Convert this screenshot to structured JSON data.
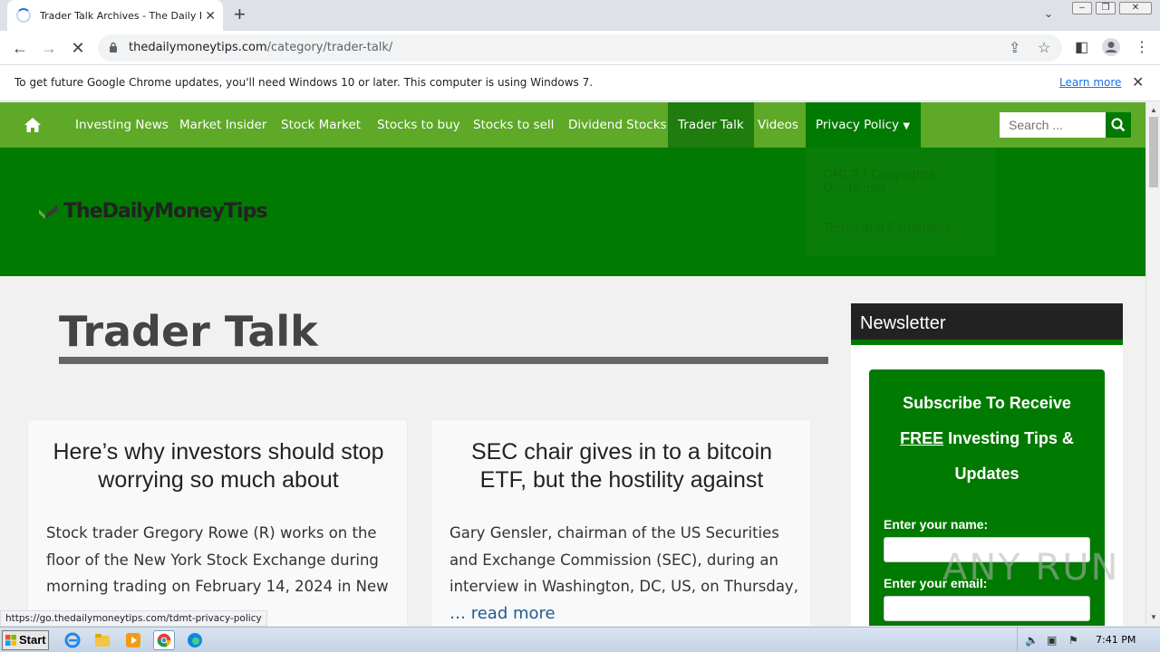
{
  "browser": {
    "tab_title": "Trader Talk Archives - The Daily Money",
    "url_host": "thedailymoneytips.com",
    "url_path": "/category/trader-talk/",
    "infobar_message": "To get future Google Chrome updates, you'll need Windows 10 or later. This computer is using Windows 7.",
    "infobar_link": "Learn more",
    "status_url": "https://go.thedailymoneytips.com/tdmt-privacy-policy"
  },
  "nav": {
    "items": [
      "Investing News",
      "Market Insider",
      "Stock Market",
      "Stocks to buy",
      "Stocks to sell",
      "Dividend Stocks",
      "Trader Talk",
      "Videos",
      "Privacy Policy"
    ],
    "search_placeholder": "Search ...",
    "dropdown": [
      "DMCA / Copyrights Disclaimer",
      "Terms and Conditions"
    ]
  },
  "logo_text": "TheDailyMoneyTips",
  "page_title": "Trader Talk",
  "posts": [
    {
      "title": "Here’s why investors should stop worrying so much about",
      "excerpt": "Stock trader Gregory Rowe (R) works on the floor of the New York Stock Exchange during morning trading on February 14, 2024 in New",
      "more": ""
    },
    {
      "title": "SEC chair gives in to a bitcoin ETF, but the hostility against",
      "excerpt": "Gary Gensler, chairman of the US Securities and Exchange Commission (SEC), during an interview in Washington, DC, US, on Thursday,",
      "more": "… read more"
    }
  ],
  "newsletter": {
    "heading": "Newsletter",
    "subscribe_line1": "Subscribe To Receive",
    "subscribe_free": "FREE",
    "subscribe_line2": "Investing Tips &",
    "subscribe_line3": "Updates",
    "name_label": "Enter your name:",
    "email_label": "Enter your email:"
  },
  "watermark": "ANY RUN",
  "taskbar": {
    "start_label": "Start",
    "clock": "7:41 PM"
  },
  "colors": {
    "nav_green": "#5ea928",
    "header_green": "#007a00",
    "active_tab_green": "#1e7d0d",
    "link_blue": "#1a73e8"
  }
}
